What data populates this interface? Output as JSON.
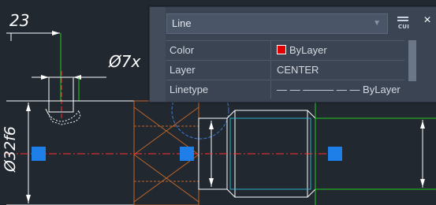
{
  "drawing": {
    "dimensions": {
      "top": "23",
      "diameter_small": "Ø7x",
      "diameter_large": "Ø32f6"
    },
    "colors": {
      "background": "#212830",
      "object_lines": "#ffffff",
      "center_lines": "#ff3030",
      "green_lines": "#22cc22",
      "cyan_lines": "#2ab0c8",
      "orange_lines": "#c0652a",
      "blue_circle": "#3a7bd5",
      "grip_fill": "#1e7fe8"
    }
  },
  "quick_properties": {
    "object_type": "Line",
    "cui_label": "CUI",
    "close_label": "×",
    "dropdown_icon": "chevron-down-icon",
    "rows": [
      {
        "name": "Color",
        "value": "ByLayer",
        "swatch_color": "#e00000"
      },
      {
        "name": "Layer",
        "value": "CENTER"
      },
      {
        "name": "Linetype",
        "value": "— — ——— — — ByLayer"
      }
    ]
  }
}
